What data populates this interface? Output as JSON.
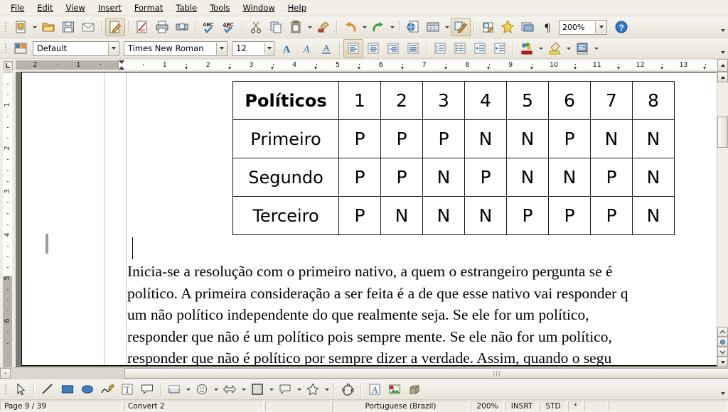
{
  "menu": {
    "items": [
      "File",
      "Edit",
      "View",
      "Insert",
      "Format",
      "Table",
      "Tools",
      "Window",
      "Help"
    ]
  },
  "standard_toolbar": {
    "icons": [
      "new-document-icon",
      "open-icon",
      "save-icon",
      "email-icon",
      "edit-file-icon",
      "export-pdf-icon",
      "print-icon",
      "print-preview-icon",
      "spelling-icon",
      "autospellcheck-icon",
      "cut-icon",
      "copy-icon",
      "paste-icon",
      "clone-formatting-icon",
      "undo-icon",
      "redo-icon",
      "hyperlink-icon",
      "table-icon",
      "show-draw-functions-icon",
      "find-replace-icon",
      "gallery-icon",
      "navigator-icon",
      "formatting-marks-icon"
    ],
    "zoom_value": "200%",
    "help_icon": "help-icon"
  },
  "format_toolbar": {
    "paragraph_style": "Default",
    "font_name": "Times New Roman",
    "font_size": "12",
    "icons": [
      "apply-style-icon",
      "bold-icon",
      "italic-icon",
      "underline-icon",
      "align-left-icon",
      "align-center-icon",
      "align-right-icon",
      "justified-icon",
      "ordered-list-icon",
      "unordered-list-icon",
      "decrease-indent-icon",
      "increase-indent-icon",
      "font-color-icon",
      "highlighting-icon",
      "background-color-icon"
    ]
  },
  "ruler": {
    "horizontal_labels": [
      "2",
      "1",
      "1",
      "2",
      "3",
      "4",
      "5",
      "6",
      "7",
      "8",
      "9",
      "10",
      "11",
      "12",
      "13"
    ],
    "vertical_labels": [
      "1",
      "2",
      "3",
      "4",
      "5",
      "6"
    ]
  },
  "document": {
    "table": {
      "header": [
        "Políticos",
        "1",
        "2",
        "3",
        "4",
        "5",
        "6",
        "7",
        "8"
      ],
      "rows": [
        [
          "Primeiro",
          "P",
          "P",
          "P",
          "N",
          "N",
          "P",
          "N",
          "N"
        ],
        [
          "Segundo",
          "P",
          "P",
          "N",
          "P",
          "N",
          "N",
          "P",
          "N"
        ],
        [
          "Terceiro",
          "P",
          "N",
          "N",
          "N",
          "P",
          "P",
          "P",
          "N"
        ]
      ]
    },
    "paragraph_lines": [
      "Inicia-se a resolução com o primeiro nativo, a quem o estrangeiro pergunta se é",
      "político. A primeira consideração a ser feita é a de que esse nativo vai responder q",
      "um não político independente do que realmente seja. Se ele for um político,",
      "responder que não é um político pois sempre mente. Se ele não for um político,",
      "responder que não é político por sempre dizer a verdade. Assim, quando o segu"
    ]
  },
  "drawing_toolbar": {
    "icons": [
      "select-icon",
      "line-icon",
      "rectangle-icon",
      "ellipse-icon",
      "freeform-line-icon",
      "text-box-icon",
      "callout-icon",
      "basic-shapes-icon",
      "symbol-shapes-icon",
      "block-arrows-icon",
      "flowchart-icon",
      "callout-shapes-icon",
      "stars-icon",
      "points-icon",
      "fontwork-icon",
      "insert-image-icon",
      "extrusion-icon"
    ]
  },
  "statusbar": {
    "page": "Page 9 / 39",
    "style": "Convert 2",
    "language": "Portuguese (Brazil)",
    "zoom": "200%",
    "insert_mode": "INSRT",
    "selection_mode": "STD",
    "modified": "*"
  },
  "colors": {
    "chrome": "#efece4",
    "toolbar_top": "#f6f4ee",
    "toolbar_bottom": "#e8e4da",
    "doc_background": "#7d7a74",
    "page": "#ffffff",
    "table_border": "#1a1a1a"
  }
}
